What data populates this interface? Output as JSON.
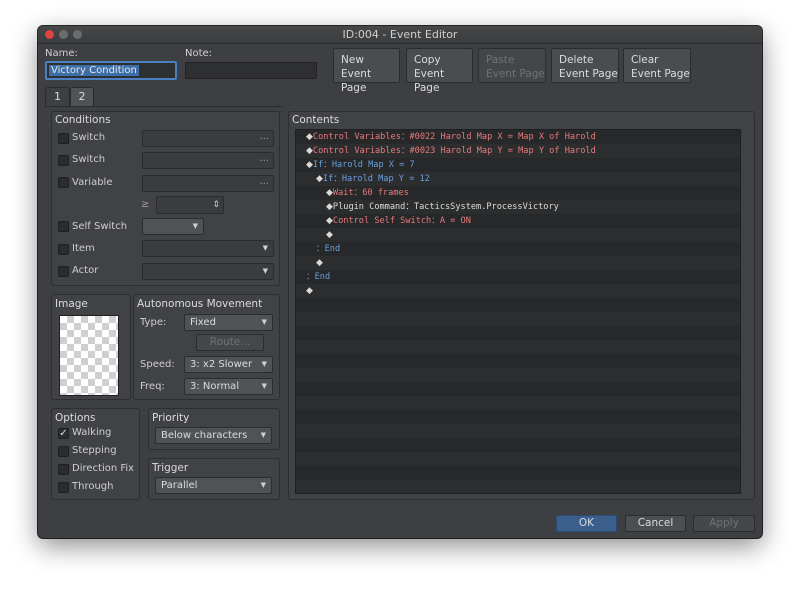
{
  "window": {
    "title": "ID:004 - Event Editor"
  },
  "header": {
    "name_label": "Name:",
    "name_value": "Victory Condition",
    "note_label": "Note:",
    "note_value": "",
    "buttons": [
      {
        "label": "New\nEvent Page",
        "enabled": true
      },
      {
        "label": "Copy\nEvent Page",
        "enabled": true
      },
      {
        "label": "Paste\nEvent Page",
        "enabled": false
      },
      {
        "label": "Delete\nEvent Page",
        "enabled": true
      },
      {
        "label": "Clear\nEvent Page",
        "enabled": true
      }
    ]
  },
  "tabs": [
    {
      "label": "1",
      "active": true
    },
    {
      "label": "2",
      "active": false
    }
  ],
  "conditions": {
    "title": "Conditions",
    "switch1": "Switch",
    "switch2": "Switch",
    "variable": "Variable",
    "gte": "≥",
    "self_switch": "Self Switch",
    "item": "Item",
    "actor": "Actor",
    "dots": "..."
  },
  "image": {
    "title": "Image"
  },
  "movement": {
    "title": "Autonomous Movement",
    "type_label": "Type:",
    "type_value": "Fixed",
    "route_label": "Route...",
    "speed_label": "Speed:",
    "speed_value": "3: x2 Slower",
    "freq_label": "Freq:",
    "freq_value": "3: Normal"
  },
  "options": {
    "title": "Options",
    "walking": "Walking",
    "stepping": "Stepping",
    "direction_fix": "Direction Fix",
    "through": "Through",
    "walking_checked": true,
    "check_mark": "✓"
  },
  "priority": {
    "title": "Priority",
    "value": "Below characters"
  },
  "trigger": {
    "title": "Trigger",
    "value": "Parallel"
  },
  "contents": {
    "title": "Contents",
    "diamond": "◆",
    "colon": "：",
    "lines": [
      {
        "cmd": "Control Variables",
        "arg": "#0022 Harold Map X = Map X of Harold"
      },
      {
        "cmd": "Control Variables",
        "arg": "#0023 Harold Map Y = Map Y of Harold"
      },
      {
        "cmd": "If",
        "arg": "Harold Map X = 7"
      },
      {
        "cmd": "If",
        "arg": "Harold Map Y = 12"
      },
      {
        "cmd": "Wait",
        "arg": "60 frames"
      },
      {
        "cmd": "Plugin Command",
        "arg": "TacticsSystem.ProcessVictory"
      },
      {
        "cmd": "Control Self Switch",
        "arg": "A = ON"
      },
      {
        "cmd": "",
        "arg": ""
      },
      {
        "cmd": "End",
        "arg": ""
      },
      {
        "cmd": "",
        "arg": ""
      },
      {
        "cmd": "End",
        "arg": ""
      },
      {
        "cmd": "",
        "arg": ""
      }
    ]
  },
  "footer": {
    "ok": "OK",
    "cancel": "Cancel",
    "apply": "Apply"
  },
  "colors": {
    "accent": "#4a7fc1",
    "command_red": "#e8797b",
    "command_blue": "#6a9fdd"
  },
  "arrow": "▼",
  "stepper_icon": "⇕"
}
